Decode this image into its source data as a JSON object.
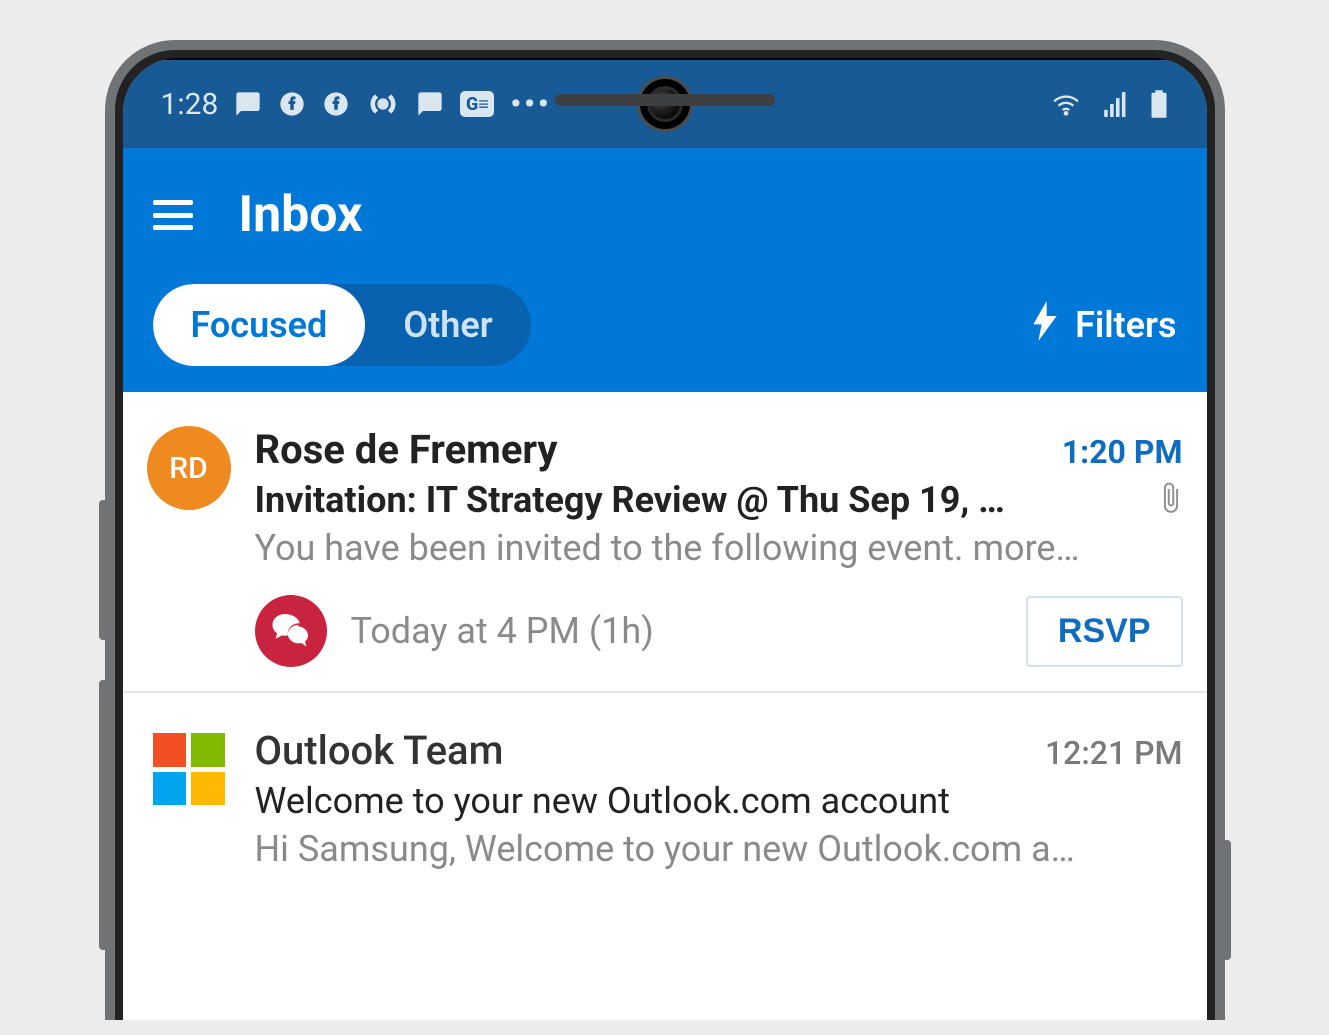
{
  "status_bar": {
    "clock": "1:28",
    "more_indicator": "•••"
  },
  "header": {
    "title": "Inbox",
    "tabs": {
      "focused": "Focused",
      "other": "Other"
    },
    "filters_label": "Filters"
  },
  "messages": [
    {
      "avatar_initials": "RD",
      "avatar_bg": "#ee8a1f",
      "sender": "Rose de Fremery",
      "time": "1:20 PM",
      "unread": true,
      "subject": "Invitation: IT Strategy Review @ Thu Sep 19, …",
      "preview": "You have been invited to the following event. more…",
      "has_attachment": true,
      "event": {
        "when": "Today at 4 PM (1h)",
        "action": "RSVP"
      }
    },
    {
      "avatar_type": "ms-logo",
      "sender": "Outlook Team",
      "time": "12:21 PM",
      "unread": false,
      "subject": "Welcome to your new Outlook.com account",
      "preview": "Hi Samsung, Welcome to your new Outlook.com a…",
      "has_attachment": false
    }
  ],
  "colors": {
    "outlook_blue": "#0078d7",
    "status_bar_blue": "#185a96",
    "link_blue": "#0f6cbf",
    "event_red": "#c8233f",
    "avatar_orange": "#ee8a1f"
  }
}
